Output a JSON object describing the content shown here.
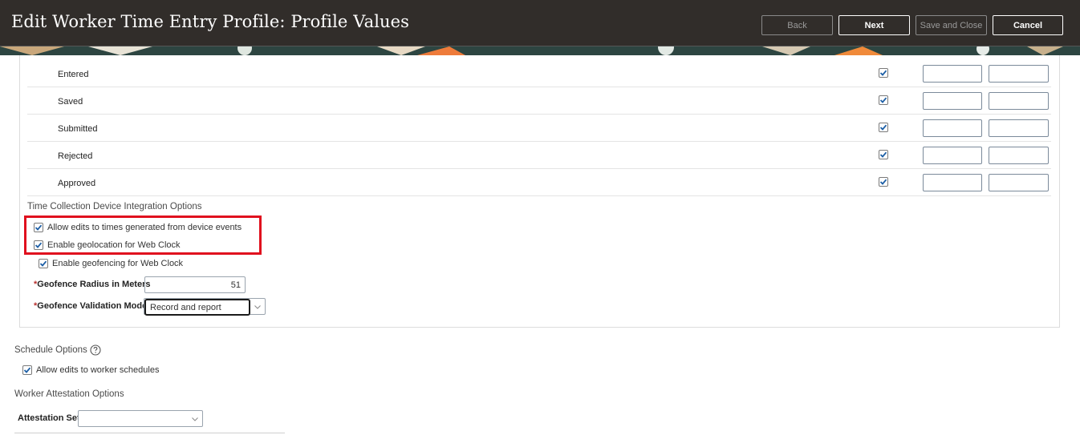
{
  "header": {
    "title": "Edit Worker Time Entry Profile: Profile Values",
    "buttons": {
      "back": "Back",
      "next": "Next",
      "save_close": "Save and Close",
      "cancel": "Cancel"
    }
  },
  "status_rows": [
    {
      "label": "Entered",
      "checked": true
    },
    {
      "label": "Saved",
      "checked": true
    },
    {
      "label": "Submitted",
      "checked": true
    },
    {
      "label": "Rejected",
      "checked": true
    },
    {
      "label": "Approved",
      "checked": true
    }
  ],
  "device_integration": {
    "title": "Time Collection Device Integration Options",
    "allow_edits": "Allow edits to times generated from device events",
    "enable_geolocation": "Enable geolocation for Web Clock",
    "enable_geofencing": "Enable geofencing for Web Clock",
    "radius_label": "Geofence Radius in Meters",
    "radius_value": "51",
    "validation_label": "Geofence Validation Mode",
    "validation_value": "Record and report",
    "required_mark": "*"
  },
  "schedule": {
    "title": "Schedule Options",
    "allow_edits": "Allow edits to worker schedules"
  },
  "attestation": {
    "title": "Worker Attestation Options",
    "set_label": "Attestation Set",
    "set_value": ""
  },
  "colors": {
    "header_bg": "#312d2a",
    "highlight": "#e0101e",
    "checkbox_accent": "#1d5fa6"
  }
}
